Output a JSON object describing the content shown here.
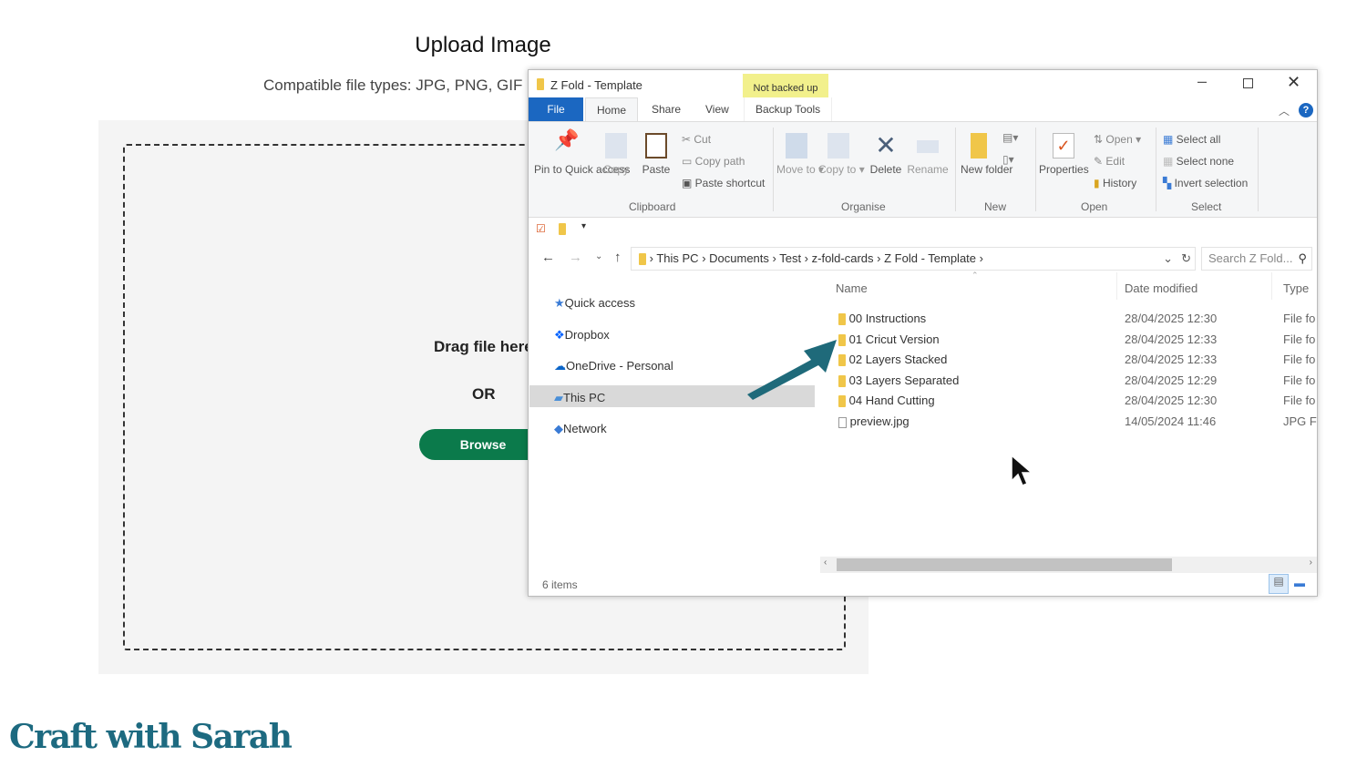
{
  "upload": {
    "title": "Upload Image",
    "types": "Compatible file types:  JPG, PNG, GIF",
    "drag": "Drag file here",
    "or": "OR",
    "browse": "Browse"
  },
  "explorer": {
    "title": "Z Fold - Template",
    "badge": "Not backed up",
    "tabs": [
      "File",
      "Home",
      "Share",
      "View",
      "Backup Tools"
    ],
    "ribbon": {
      "pin": "Pin to Quick access",
      "copy": "Copy",
      "paste": "Paste",
      "cut": "Cut",
      "copy_path": "Copy path",
      "paste_shortcut": "Paste shortcut",
      "move_to": "Move to ▾",
      "copy_to": "Copy to ▾",
      "delete": "Delete",
      "rename": "Rename",
      "new_folder": "New folder",
      "properties": "Properties",
      "open": "Open ▾",
      "edit": "Edit",
      "history": "History",
      "select_all": "Select all",
      "select_none": "Select none",
      "invert_selection": "Invert selection",
      "groups": [
        "Clipboard",
        "Organise",
        "New",
        "Open",
        "Select"
      ]
    },
    "breadcrumb": [
      "This PC",
      "Documents",
      "Test",
      "z-fold-cards",
      "Z Fold - Template"
    ],
    "search_placeholder": "Search Z Fold...",
    "nav": [
      "Quick access",
      "Dropbox",
      "OneDrive - Personal",
      "This PC",
      "Network"
    ],
    "columns": [
      "Name",
      "Date modified",
      "Type"
    ],
    "files": [
      {
        "name": "00 Instructions",
        "date": "28/04/2025 12:30",
        "type": "File fo"
      },
      {
        "name": "01 Cricut Version",
        "date": "28/04/2025 12:33",
        "type": "File fo"
      },
      {
        "name": "02 Layers Stacked",
        "date": "28/04/2025 12:33",
        "type": "File fo"
      },
      {
        "name": "03 Layers Separated",
        "date": "28/04/2025 12:29",
        "type": "File fo"
      },
      {
        "name": "04 Hand Cutting",
        "date": "28/04/2025 12:30",
        "type": "File fo"
      },
      {
        "name": "preview.jpg",
        "date": "14/05/2024 11:46",
        "type": "JPG Fil"
      }
    ],
    "status": "6 items"
  },
  "brand": {
    "logo": "Craft with Sarah",
    "color": "#1d6a80"
  },
  "colors": {
    "browse": "#0b7a4b",
    "arrow": "#1f6a7a",
    "file_tab": "#1b67c1"
  }
}
